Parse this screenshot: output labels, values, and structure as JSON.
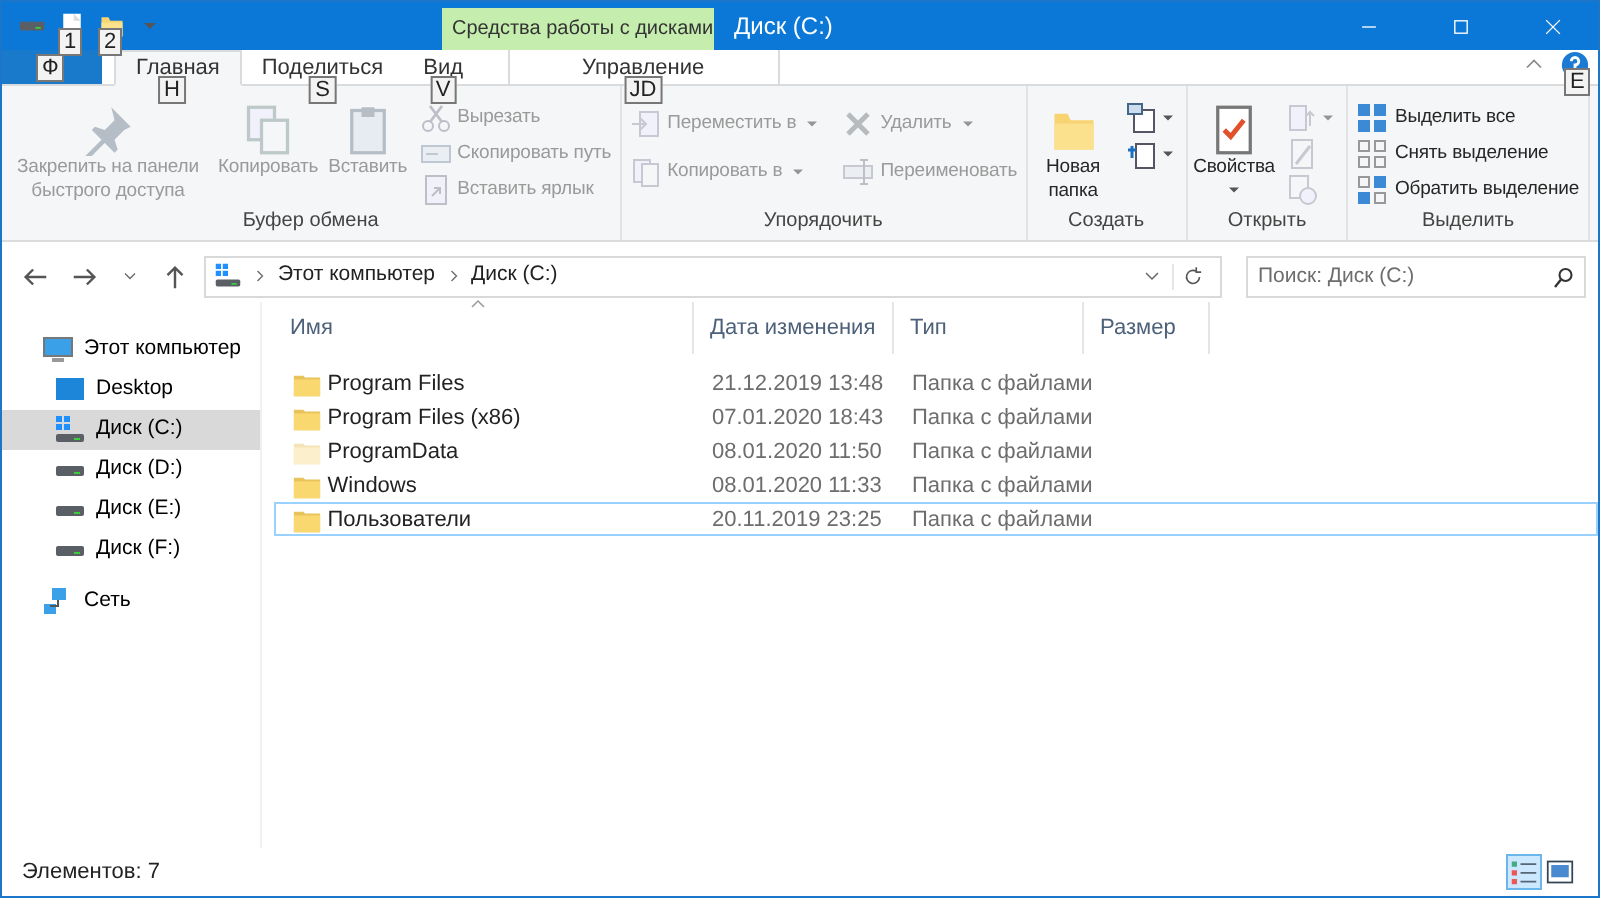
{
  "window": {
    "title": "Диск (C:)",
    "context_tab": "Средства работы с дисками",
    "quick_access_keytips": [
      "1",
      "2"
    ]
  },
  "ribbon_tabs": [
    {
      "kind": "file",
      "keytip": "Ф",
      "selected": false
    },
    {
      "kind": "tab",
      "label": "Главная",
      "keytip": "H",
      "selected": true
    },
    {
      "kind": "tab",
      "label": "Поделиться",
      "keytip": "S",
      "selected": false
    },
    {
      "kind": "tab",
      "label": "Вид",
      "keytip": "V",
      "selected": false
    },
    {
      "kind": "context",
      "label": "Управление",
      "keytip": "JD",
      "selected": false
    }
  ],
  "help_keytip": "E",
  "ribbon_groups": [
    {
      "label": "Буфер обмена",
      "columns": [
        [
          {
            "kind": "large",
            "label": "Закрепить на панели быстрого доступа",
            "disabled": true
          }
        ],
        [
          {
            "kind": "large",
            "label": "Копировать",
            "disabled": true
          }
        ],
        [
          {
            "kind": "large",
            "label": "Вставить",
            "disabled": true
          }
        ],
        [
          {
            "kind": "small",
            "label": "Вырезать",
            "disabled": true
          },
          {
            "kind": "small",
            "label": "Скопировать путь",
            "disabled": true
          },
          {
            "kind": "small",
            "label": "Вставить ярлык",
            "disabled": true
          }
        ]
      ]
    },
    {
      "label": "Упорядочить",
      "columns": [
        [
          {
            "kind": "small",
            "label": "Переместить в",
            "dropdown": true,
            "disabled": true
          },
          {
            "kind": "small",
            "label": "Копировать в",
            "dropdown": true,
            "disabled": true
          }
        ],
        [
          {
            "kind": "small",
            "label": "Удалить",
            "dropdown": true,
            "disabled": true
          },
          {
            "kind": "small",
            "label": "Переименовать",
            "disabled": true
          }
        ]
      ]
    },
    {
      "label": "Создать",
      "columns": [
        [
          {
            "kind": "large",
            "label": "Новая папка",
            "disabled": false
          }
        ],
        [
          {
            "kind": "icon",
            "dropdown": true,
            "disabled": false
          },
          {
            "kind": "icon",
            "dropdown": true,
            "disabled": false
          }
        ]
      ]
    },
    {
      "label": "Открыть",
      "columns": [
        [
          {
            "kind": "large",
            "label": "Свойства",
            "dropdown": true,
            "disabled": false
          }
        ],
        [
          {
            "kind": "icon",
            "dropdown": true,
            "disabled": true
          },
          {
            "kind": "icon",
            "disabled": true
          },
          {
            "kind": "icon",
            "disabled": true
          }
        ]
      ]
    },
    {
      "label": "Выделить",
      "columns": [
        [
          {
            "kind": "small",
            "label": "Выделить все",
            "disabled": false
          },
          {
            "kind": "small",
            "label": "Снять выделение",
            "disabled": false
          },
          {
            "kind": "small",
            "label": "Обратить выделение",
            "disabled": false
          }
        ]
      ]
    }
  ],
  "address": {
    "breadcrumb": [
      "Этот компьютер",
      "Диск (C:)"
    ],
    "search_placeholder": "Поиск: Диск (C:)"
  },
  "nav_tree": [
    {
      "kind": "computer",
      "label": "Этот компьютер",
      "selected": false,
      "children": [
        {
          "kind": "desktop",
          "label": "Desktop",
          "selected": false
        },
        {
          "kind": "system-drive",
          "label": "Диск (C:)",
          "selected": true
        },
        {
          "kind": "drive",
          "label": "Диск (D:)",
          "selected": false
        },
        {
          "kind": "drive",
          "label": "Диск (E:)",
          "selected": false
        },
        {
          "kind": "drive",
          "label": "Диск (F:)",
          "selected": false
        }
      ]
    },
    {
      "kind": "network",
      "label": "Сеть",
      "selected": false
    }
  ],
  "file_list": {
    "columns": [
      "Имя",
      "Дата изменения",
      "Тип",
      "Размер"
    ],
    "rows": [
      {
        "name": "Program Files",
        "date": "21.12.2019 13:48",
        "type": "Папка с файлами",
        "hidden": false,
        "focused": false
      },
      {
        "name": "Program Files (x86)",
        "date": "07.01.2020 18:43",
        "type": "Папка с файлами",
        "hidden": false,
        "focused": false
      },
      {
        "name": "ProgramData",
        "date": "08.01.2020 11:50",
        "type": "Папка с файлами",
        "hidden": true,
        "focused": false
      },
      {
        "name": "Windows",
        "date": "08.01.2020 11:33",
        "type": "Папка с файлами",
        "hidden": false,
        "focused": false
      },
      {
        "name": "Пользователи",
        "date": "20.11.2019 23:25",
        "type": "Папка с файлами",
        "hidden": false,
        "focused": true
      }
    ]
  },
  "status_bar": {
    "text": "Элементов: 7",
    "view_buttons": [
      {
        "selected": true
      },
      {
        "selected": false
      }
    ]
  }
}
